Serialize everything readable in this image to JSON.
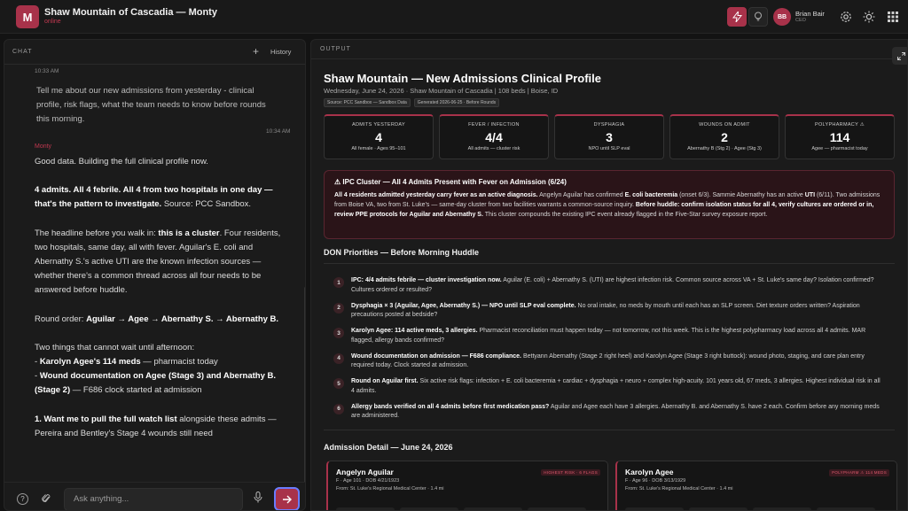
{
  "app": {
    "logo_letter": "M",
    "title": "Shaw Mountain of Cascadia — Monty",
    "status": "online",
    "user": {
      "initials": "BB",
      "name": "Brian Bair",
      "role": "CEO"
    }
  },
  "icons": {
    "bolt": "bolt-icon",
    "bulb": "lightbulb-icon",
    "settings": "gear-icon",
    "theme": "sun-icon",
    "apps": "grid-icon",
    "help": "help-icon",
    "attach": "paperclip-icon",
    "mic": "microphone-icon",
    "send": "arrow-right-icon",
    "expand": "expand-icon"
  },
  "colors": {
    "accent": "#a8324a",
    "accent_text": "#c03850",
    "background": "#131313",
    "panel": "#1b1b1b"
  },
  "chat": {
    "label": "CHAT",
    "new_label": "+",
    "history_label": "History",
    "top_time": "10:33 AM",
    "user_message": "Tell me about our new admissions from yesterday - clinical profile, risk flags, what the team needs to know before rounds this morning.",
    "user_time": "10:34 AM",
    "bot_name": "Monty",
    "p1": "Good data. Building the full clinical profile now.",
    "p2_bold": "4 admits. All 4 febrile. All 4 from two hospitals in one day — that's the pattern to investigate.",
    "p2_rest": " Source: PCC Sandbox.",
    "p3_a": "The headline before you walk in: ",
    "p3_bold": "this is a cluster",
    "p3_b": ". Four residents, two hospitals, same day, all with fever. Aguilar's E. coli and Abernathy S.'s active UTI are the known infection sources — whether there's a common thread across all four needs to be answered before huddle.",
    "p4_a": "Round order: ",
    "p4_bold": "Aguilar → Agee → Abernathy S. → Abernathy B.",
    "p5_a": "Two things that cannot wait until afternoon:",
    "p5_b1_bold": "Karolyn Agee's 114 meds",
    "p5_b1": " — pharmacist today",
    "p5_b2_bold": "Wound documentation on Agee (Stage 3) and Abernathy B. (Stage 2)",
    "p5_b2": " — F686 clock started at admission",
    "p6_bold": "1. Want me to pull the full watch list",
    "p6_rest": " alongside these admits — Pereira and Bentley's Stage 4 wounds still need",
    "input_placeholder": "Ask anything..."
  },
  "output": {
    "label": "OUTPUT",
    "title": "Shaw Mountain — New Admissions Clinical Profile",
    "subtitle": "Wednesday, June 24, 2026 · Shaw Mountain of Cascadia | 108 beds | Boise, ID",
    "tags": [
      "Source: PCC Sandbox — Sandbox Data",
      "Generated 2026-06-25 · Before Rounds"
    ],
    "stats": [
      {
        "label": "ADMITS YESTERDAY",
        "value": "4",
        "sub": "All female · Ages 95–101"
      },
      {
        "label": "FEVER / INFECTION",
        "value": "4/4",
        "sub": "All admits — cluster risk"
      },
      {
        "label": "DYSPHAGIA",
        "value": "3",
        "sub": "NPO until SLP eval"
      },
      {
        "label": "WOUNDS ON ADMIT",
        "value": "2",
        "sub": "Abernathy B (Stg 2) · Agee (Stg 3)"
      },
      {
        "label": "POLYPHARMACY ⚠",
        "value": "114",
        "sub": "Agee — pharmacist today"
      }
    ],
    "alert": {
      "title": "⚠ IPC Cluster — All 4 Admits Present with Fever on Admission (6/24)",
      "b1": "All 4 residents admitted yesterday carry fever as an active diagnosis.",
      "t1": " Angelyn Aguilar has confirmed ",
      "b2": "E. coli bacteremia",
      "t2": " (onset 6/3). Sammie Abernathy has an active ",
      "b3": "UTI",
      "t3": " (6/11). Two admissions from Boise VA, two from St. Luke's — same-day cluster from two facilities warrants a common-source inquiry. ",
      "b4": "Before huddle: confirm isolation status for all 4, verify cultures are ordered or in, review PPE protocols for Aguilar and Abernathy S.",
      "t4": " This cluster compounds the existing IPC event already flagged in the Five-Star survey exposure report."
    },
    "priorities_title": "DON Priorities — Before Morning Huddle",
    "priorities": [
      {
        "num": "1",
        "bold": "IPC: 4/4 admits febrile — cluster investigation now.",
        "text": " Aguilar (E. coli) + Abernathy S. (UTI) are highest infection risk. Common source across VA + St. Luke's same day? Isolation confirmed? Cultures ordered or resulted?"
      },
      {
        "num": "2",
        "bold": "Dysphagia × 3 (Aguilar, Agee, Abernathy S.) — NPO until SLP eval complete.",
        "text": " No oral intake, no meds by mouth until each has an SLP screen. Diet texture orders written? Aspiration precautions posted at bedside?"
      },
      {
        "num": "3",
        "bold": "Karolyn Agee: 114 active meds, 3 allergies.",
        "text": " Pharmacist reconciliation must happen today — not tomorrow, not this week. This is the highest polypharmacy load across all 4 admits. MAR flagged, allergy bands confirmed?"
      },
      {
        "num": "4",
        "bold": "Wound documentation on admission — F686 compliance.",
        "text": " Bettyann Abernathy (Stage 2 right heel) and Karolyn Agee (Stage 3 right buttock): wound photo, staging, and care plan entry required today. Clock started at admission."
      },
      {
        "num": "5",
        "bold": "Round on Aguilar first.",
        "text": " Six active risk flags: infection + E. coli bacteremia + cardiac + dysphagia + neuro + complex high-acuity. 101 years old, 67 meds, 3 allergies. Highest individual risk in all 4 admits."
      },
      {
        "num": "6",
        "bold": "Allergy bands verified on all 4 admits before first medication pass?",
        "text": " Aguilar and Agee each have 3 allergies. Abernathy B. and Abernathy S. have 2 each. Confirm before any morning meds are administered."
      }
    ],
    "detail_title": "Admission Detail — June 24, 2026",
    "admissions": [
      {
        "name": "Angelyn Aguilar",
        "flag": "HIGHEST RISK · 6 FLAGS",
        "meta": "F · Age 101 · DOB 4/21/1923",
        "from": "From: St. Luke's Regional Medical Center · 1.4 mi"
      },
      {
        "name": "Karolyn Agee",
        "flag": "POLYPHARM ⚠ 114 MEDS",
        "meta": "F · Age 96 · DOB 3/13/1929",
        "from": "From: St. Luke's Regional Medical Center · 1.4 mi"
      }
    ]
  }
}
